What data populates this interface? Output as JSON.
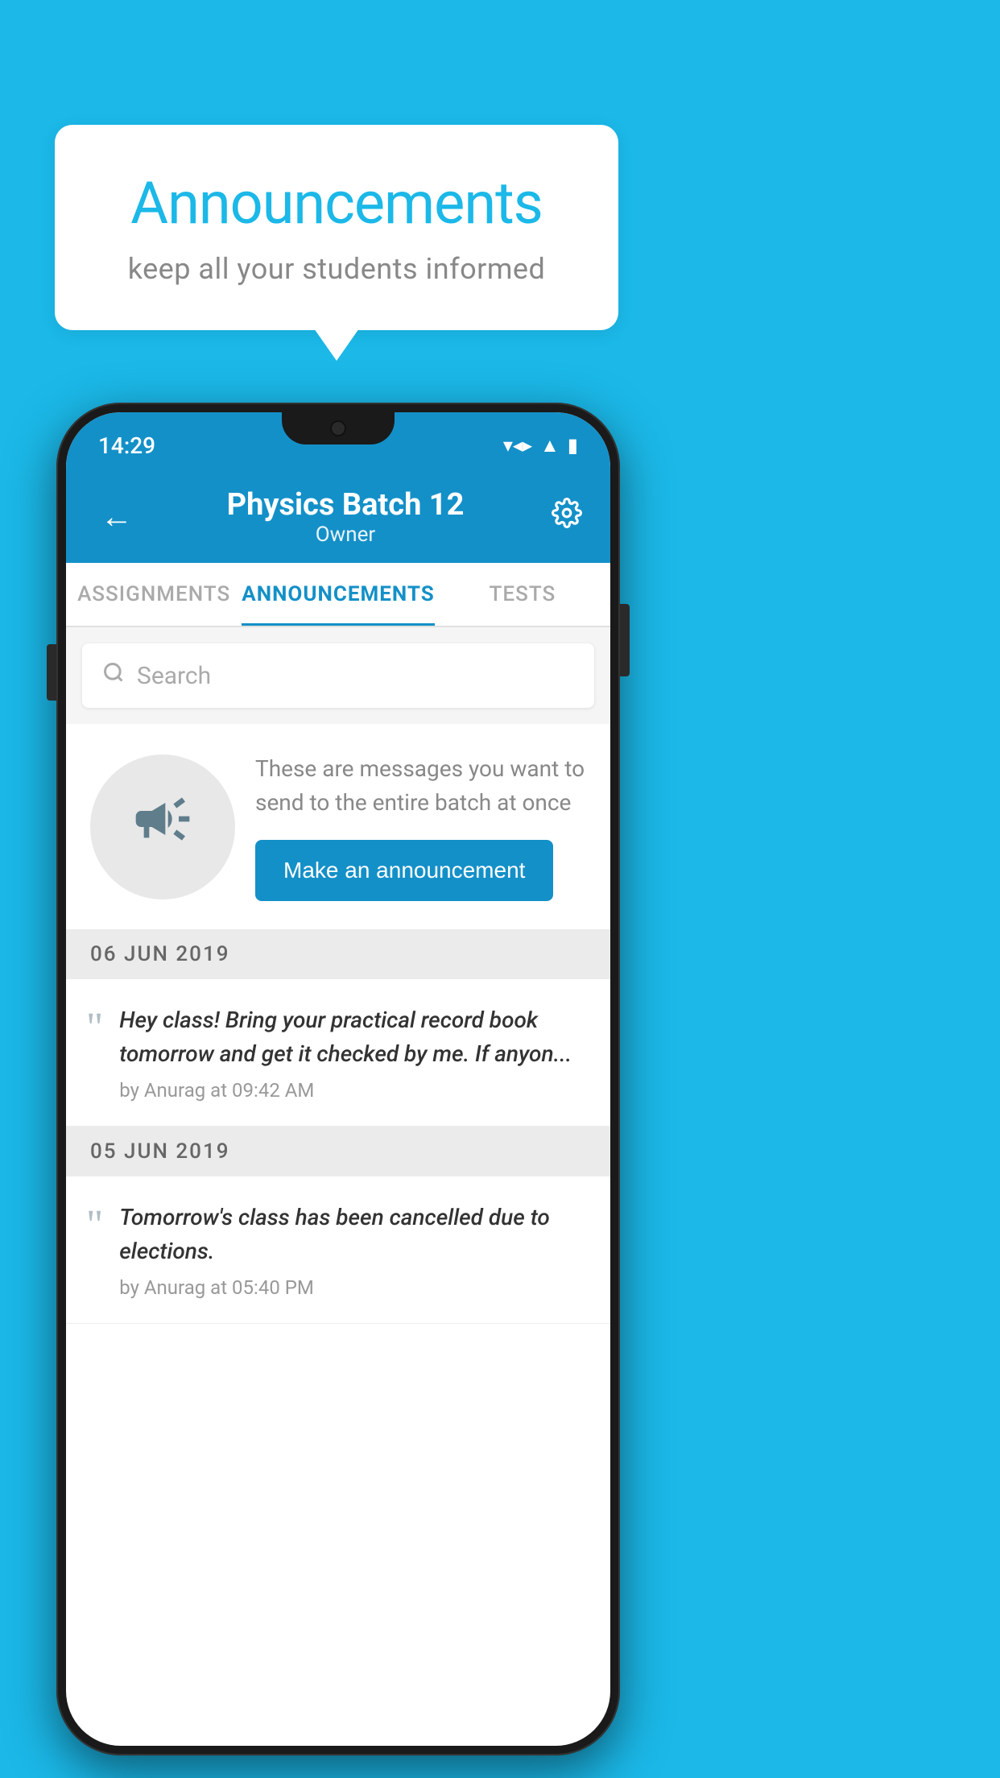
{
  "background_color": "#1bb8e8",
  "bubble": {
    "title": "Announcements",
    "subtitle": "keep all your students informed"
  },
  "status_bar": {
    "time": "14:29",
    "icons": [
      "wifi",
      "signal",
      "battery"
    ]
  },
  "header": {
    "title": "Physics Batch 12",
    "subtitle": "Owner",
    "back_label": "←",
    "settings_label": "⚙"
  },
  "tabs": [
    {
      "label": "ASSIGNMENTS",
      "active": false
    },
    {
      "label": "ANNOUNCEMENTS",
      "active": true
    },
    {
      "label": "TESTS",
      "active": false
    }
  ],
  "search": {
    "placeholder": "Search"
  },
  "intro": {
    "description": "These are messages you want to send to the entire batch at once",
    "button_label": "Make an announcement"
  },
  "date_groups": [
    {
      "date": "06  JUN  2019",
      "announcements": [
        {
          "text": "Hey class! Bring your practical record book tomorrow and get it checked by me. If anyon...",
          "meta": "by Anurag at 09:42 AM"
        }
      ]
    },
    {
      "date": "05  JUN  2019",
      "announcements": [
        {
          "text": "Tomorrow's class has been cancelled due to elections.",
          "meta": "by Anurag at 05:40 PM"
        }
      ]
    }
  ]
}
